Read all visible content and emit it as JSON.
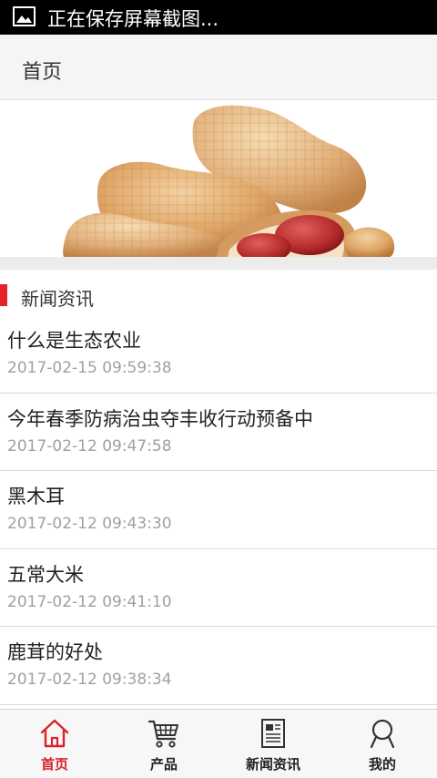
{
  "status_bar": {
    "notification_icon": "image-icon",
    "text": "正在保存屏幕截图..."
  },
  "header": {
    "title": "首页"
  },
  "banner": {
    "image": "peanuts-banner"
  },
  "news_section": {
    "title": "新闻资讯",
    "accent_color": "#e5222a",
    "items": [
      {
        "title": "什么是生态农业",
        "date": "2017-02-15 09:59:38"
      },
      {
        "title": "今年春季防病治虫夺丰收行动预备中",
        "date": "2017-02-12 09:47:58"
      },
      {
        "title": "黑木耳",
        "date": "2017-02-12 09:43:30"
      },
      {
        "title": "五常大米",
        "date": "2017-02-12 09:41:10"
      },
      {
        "title": "鹿茸的好处",
        "date": "2017-02-12 09:38:34"
      }
    ]
  },
  "tab_bar": {
    "active_color": "#d9232b",
    "tabs": [
      {
        "label": "首页",
        "icon": "home-icon",
        "active": true
      },
      {
        "label": "产品",
        "icon": "cart-icon",
        "active": false
      },
      {
        "label": "新闻资讯",
        "icon": "newspaper-icon",
        "active": false
      },
      {
        "label": "我的",
        "icon": "user-icon",
        "active": false
      }
    ]
  }
}
